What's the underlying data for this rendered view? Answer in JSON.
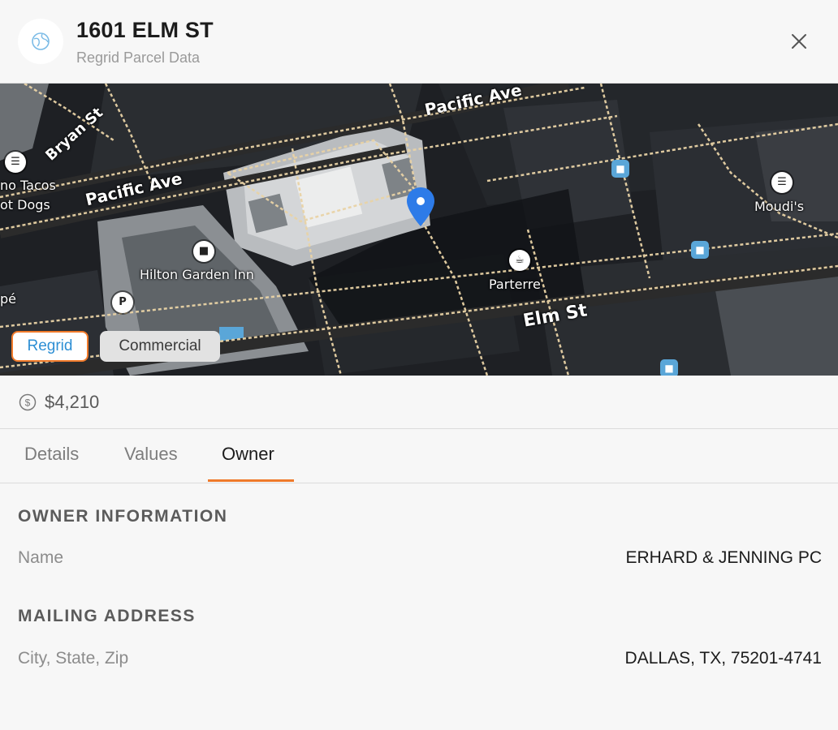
{
  "header": {
    "title": "1601 ELM ST",
    "subtitle": "Regrid Parcel Data",
    "logo_icon": "globe-icon",
    "close_icon": "close-icon"
  },
  "map": {
    "street_labels": [
      "Pacific Ave",
      "Bryan St",
      "Pacific Ave",
      "Elm St"
    ],
    "poi_labels": [
      "Hilton Garden Inn",
      "Parterre",
      "Moudi's",
      "no Tacos",
      "ot Dogs",
      "pé"
    ],
    "tags": {
      "regrid": "Regrid",
      "commercial": "Commercial"
    },
    "colors": {
      "pin": "#2d7be8",
      "tag_border": "#f07a2a",
      "tag_text": "#2e8fd4"
    }
  },
  "price": {
    "icon": "dollar-circle-icon",
    "value": "$4,210"
  },
  "tabs": [
    {
      "label": "Details",
      "active": false
    },
    {
      "label": "Values",
      "active": false
    },
    {
      "label": "Owner",
      "active": true
    }
  ],
  "owner": {
    "section_title": "OWNER INFORMATION",
    "name_label": "Name",
    "name_value": "ERHARD & JENNING PC"
  },
  "mailing": {
    "section_title": "MAILING ADDRESS",
    "csz_label": "City, State, Zip",
    "csz_value": "DALLAS, TX, 75201-4741"
  },
  "accent_color": "#ef7a2b"
}
